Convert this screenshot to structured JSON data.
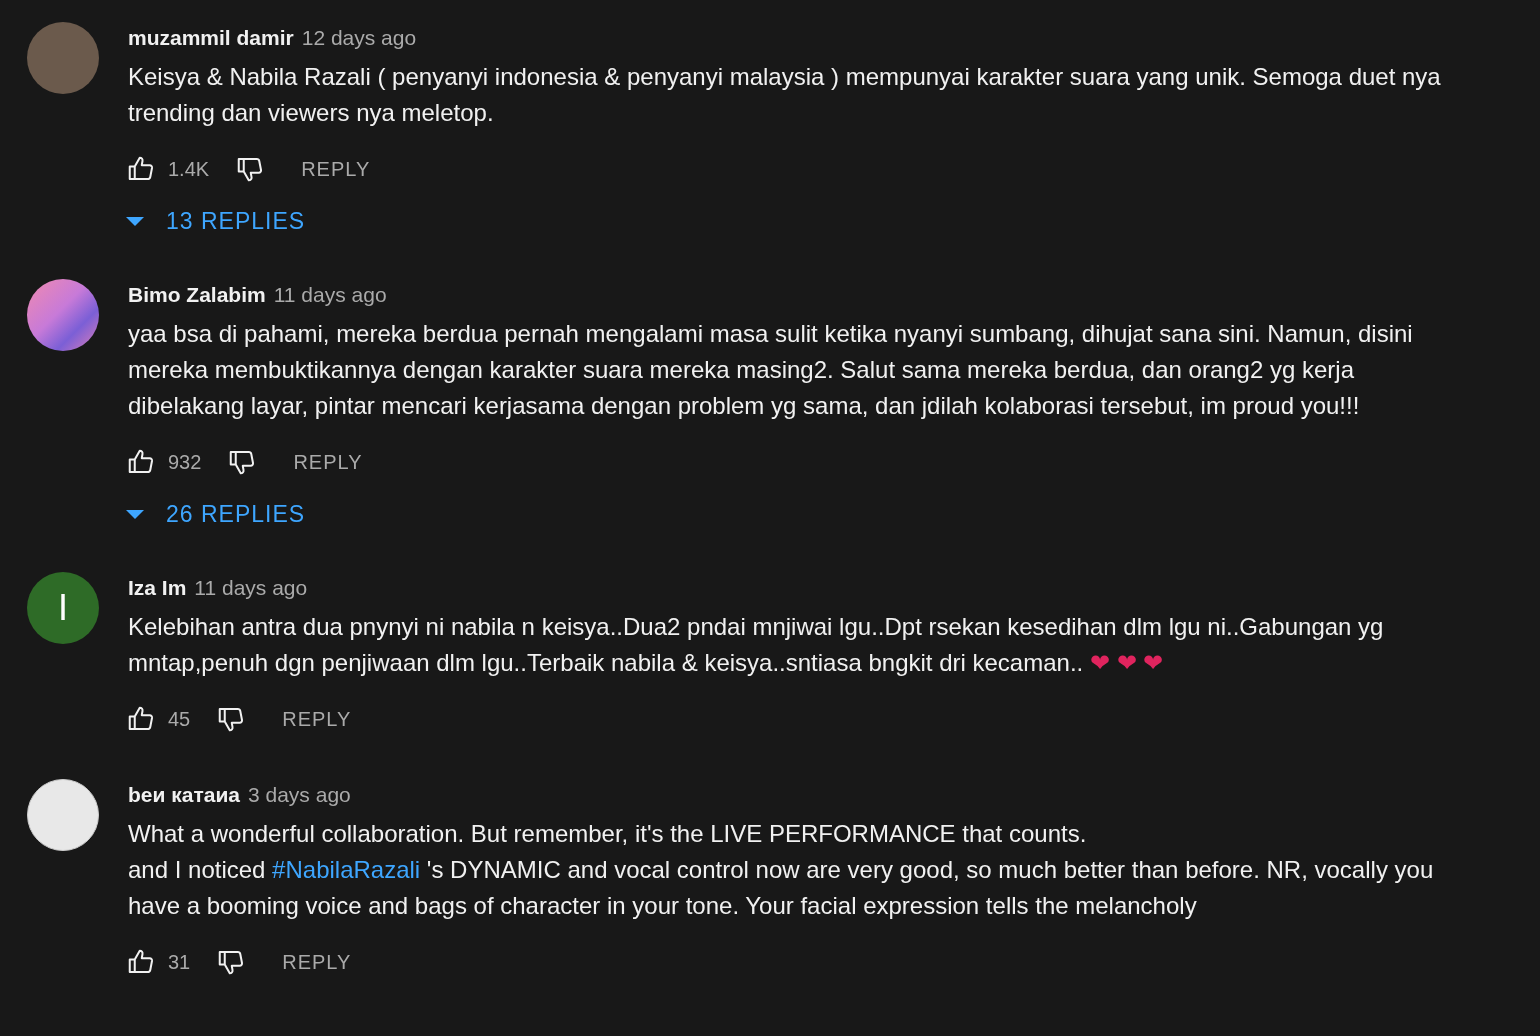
{
  "comments": [
    {
      "author": "muzammil damir",
      "time": "12 days ago",
      "avatar": {
        "kind": "photo"
      },
      "paragraphs": [
        [
          {
            "kind": "text",
            "text": "Keisya & Nabila Razali ( penyanyi indonesia & penyanyi malaysia ) mempunyai karakter suara yang unik. Semoga duet nya trending dan viewers nya meletop."
          }
        ]
      ],
      "likes": "1.4K",
      "reply_label": "REPLY",
      "replies": "13 REPLIES"
    },
    {
      "author": "Bimo Zalabim",
      "time": "11 days ago",
      "avatar": {
        "kind": "art"
      },
      "paragraphs": [
        [
          {
            "kind": "text",
            "text": "yaa bsa di pahami, mereka berdua pernah mengalami masa sulit ketika nyanyi sumbang, dihujat sana sini. Namun, disini mereka membuktikannya dengan karakter suara mereka masing2. Salut sama mereka berdua, dan orang2 yg kerja dibelakang layar, pintar mencari kerjasama dengan problem yg sama, dan jdilah kolaborasi tersebut, im proud you!!!"
          }
        ]
      ],
      "likes": "932",
      "reply_label": "REPLY",
      "replies": "26 REPLIES"
    },
    {
      "author": "Iza Im",
      "time": "11 days ago",
      "avatar": {
        "kind": "letter",
        "letter": "I",
        "color": "#2e6b27"
      },
      "paragraphs": [
        [
          {
            "kind": "text",
            "text": "Kelebihan antra dua pnynyi ni nabila n keisya..Dua2 pndai mnjiwai lgu..Dpt rsekan kesedihan dlm lgu ni..Gabungan yg mntap,penuh dgn penjiwaan dlm lgu..Terbaik nabila & keisya..sntiasa bngkit dri kecaman.. "
          },
          {
            "kind": "emoji",
            "text": "❤ ❤ ❤"
          }
        ]
      ],
      "likes": "45",
      "reply_label": "REPLY"
    },
    {
      "author": "beи катаиа",
      "time": "3 days ago",
      "avatar": {
        "kind": "picture"
      },
      "paragraphs": [
        [
          {
            "kind": "text",
            "text": "What a wonderful collaboration.  But remember, it's the LIVE PERFORMANCE  that counts."
          }
        ],
        [
          {
            "kind": "text",
            "text": "and I noticed "
          },
          {
            "kind": "link",
            "text": "#NabilaRazali"
          },
          {
            "kind": "text",
            "text": " 's  DYNAMIC and vocal control now are very good, so much better than before.  NR, vocally you have a booming voice and bags of character in your tone.  Your facial expression tells the melancholy"
          }
        ]
      ],
      "likes": "31",
      "reply_label": "REPLY"
    }
  ]
}
